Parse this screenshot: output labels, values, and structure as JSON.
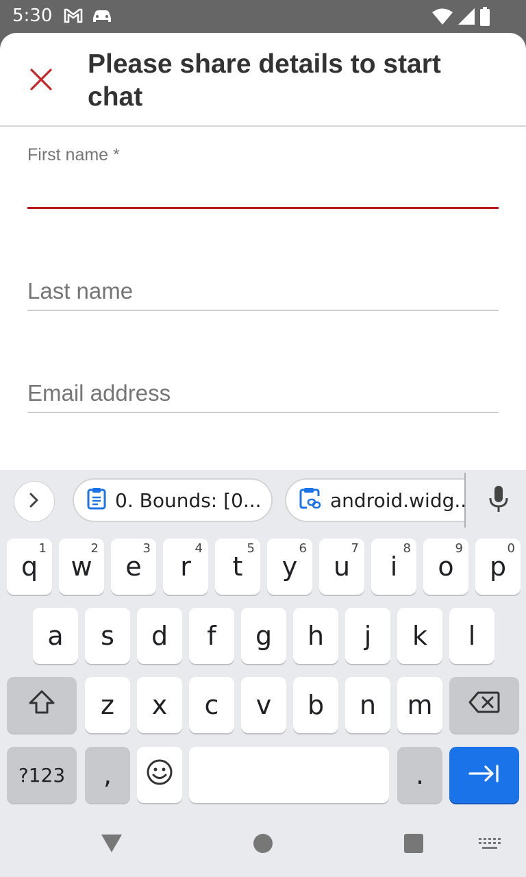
{
  "status_bar": {
    "time": "5:30"
  },
  "header": {
    "title": "Please share details to start chat"
  },
  "form": {
    "first_name_label": "First name *",
    "first_name_value": "",
    "last_name_placeholder": "Last name",
    "email_placeholder": "Email address"
  },
  "keyboard": {
    "clipboard_chips": [
      "0. Bounds: [0...",
      "android.widg..."
    ],
    "row1": [
      {
        "key": "q",
        "hint": "1"
      },
      {
        "key": "w",
        "hint": "2"
      },
      {
        "key": "e",
        "hint": "3"
      },
      {
        "key": "r",
        "hint": "4"
      },
      {
        "key": "t",
        "hint": "5"
      },
      {
        "key": "y",
        "hint": "6"
      },
      {
        "key": "u",
        "hint": "7"
      },
      {
        "key": "i",
        "hint": "8"
      },
      {
        "key": "o",
        "hint": "9"
      },
      {
        "key": "p",
        "hint": "0"
      }
    ],
    "row2": [
      "a",
      "s",
      "d",
      "f",
      "g",
      "h",
      "j",
      "k",
      "l"
    ],
    "row3": [
      "z",
      "x",
      "c",
      "v",
      "b",
      "n",
      "m"
    ],
    "symbols_label": "?123",
    "comma_label": ",",
    "period_label": "."
  },
  "colors": {
    "accent_red": "#b71c1c",
    "keyboard_blue": "#1a73e8"
  }
}
